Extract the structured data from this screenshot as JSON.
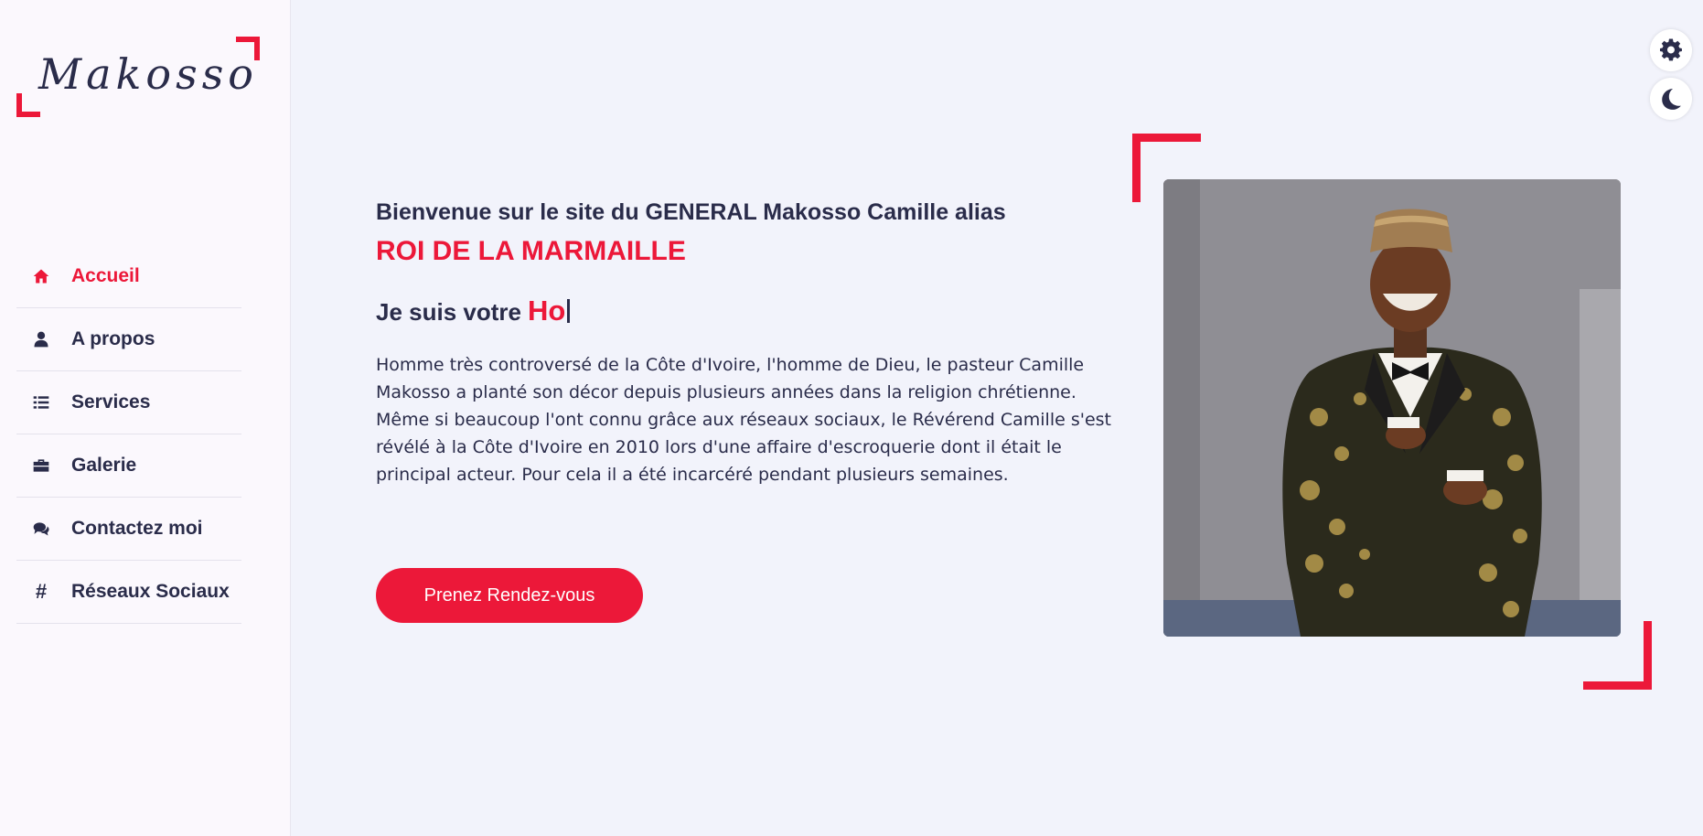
{
  "brand": {
    "logo_text": "Makosso"
  },
  "nav": {
    "items": [
      {
        "label": "Accueil",
        "icon": "home-icon",
        "active": true
      },
      {
        "label": "A propos",
        "icon": "user-icon",
        "active": false
      },
      {
        "label": "Services",
        "icon": "list-icon",
        "active": false
      },
      {
        "label": "Galerie",
        "icon": "briefcase-icon",
        "active": false
      },
      {
        "label": "Contactez moi",
        "icon": "comments-icon",
        "active": false
      },
      {
        "label": "Réseaux Sociaux",
        "icon": "hashtag-icon",
        "active": false
      }
    ]
  },
  "controls": {
    "settings_icon": "gear-icon",
    "theme_icon": "moon-icon"
  },
  "hero": {
    "greeting": "Bienvenue sur le site du GENERAL Makosso Camille alias",
    "subtitle": "ROI DE LA MARMAILLE",
    "typing_prefix": "Je suis votre",
    "typing_text": "Ho",
    "bio": "Homme très controversé de la Côte d'Ivoire, l'homme de Dieu, le pasteur Camille Makosso a planté son décor depuis plusieurs années dans la religion chrétienne. Même si beaucoup l'ont connu grâce aux réseaux sociaux, le Révérend Camille s'est révélé à la Côte d'Ivoire en 2010 lors d'une affaire d'escroquerie dont il était le principal acteur. Pour cela il a été incarcéré pendant plusieurs semaines.",
    "cta_label": "Prenez Rendez-vous"
  },
  "colors": {
    "accent": "#ec1839",
    "text": "#2a2c4a",
    "background": "#f2f3fb",
    "sidebar": "#fbf8fd"
  }
}
